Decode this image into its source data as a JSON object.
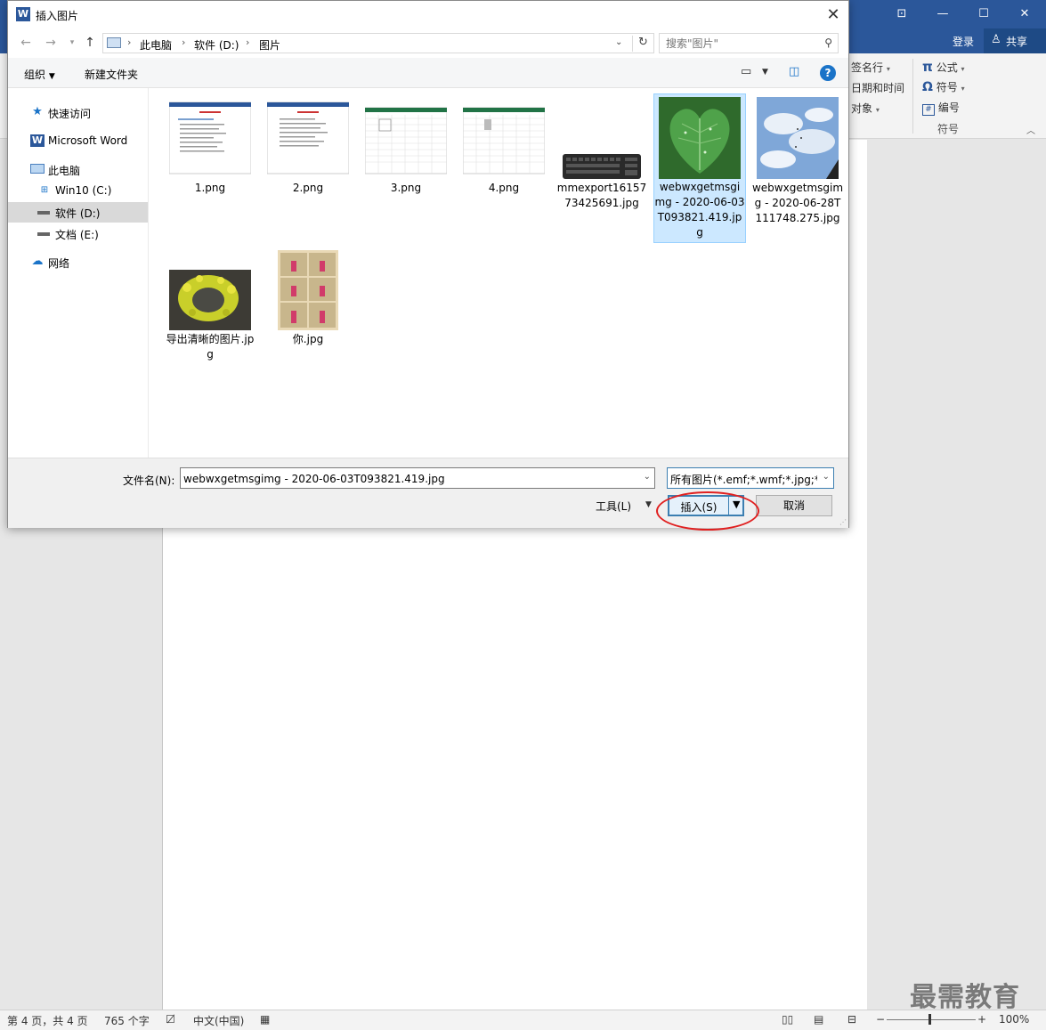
{
  "word": {
    "login": "登录",
    "share": "共享",
    "ribbon": {
      "signature_line": "签名行",
      "date_time": "日期和时间",
      "object": "对象",
      "formula": "公式",
      "symbol": "符号",
      "number": "编号",
      "group_label": "符号"
    },
    "status": {
      "page": "第 4 页，共 4 页",
      "words": "765 个字",
      "language": "中文(中国)",
      "zoom": "100%"
    },
    "watermark": "最需教育"
  },
  "dialog": {
    "title": "插入图片",
    "breadcrumb": [
      "此电脑",
      "软件 (D:)",
      "图片"
    ],
    "search_placeholder": "搜索\"图片\"",
    "organize": "组织",
    "new_folder": "新建文件夹",
    "nav": [
      {
        "label": "快速访问",
        "icon": "star-icon"
      },
      {
        "label": "Microsoft Word",
        "icon": "word-icon"
      },
      {
        "label": "此电脑",
        "icon": "computer-icon"
      },
      {
        "label": "Win10 (C:)",
        "icon": "drive-icon"
      },
      {
        "label": "软件 (D:)",
        "icon": "drive-icon",
        "selected": true
      },
      {
        "label": "文档 (E:)",
        "icon": "drive-icon"
      },
      {
        "label": "网络",
        "icon": "network-icon"
      }
    ],
    "files": [
      {
        "name": "1.png",
        "thumb": "doc"
      },
      {
        "name": "2.png",
        "thumb": "doc"
      },
      {
        "name": "3.png",
        "thumb": "sheet"
      },
      {
        "name": "4.png",
        "thumb": "sheet"
      },
      {
        "name": "mmexport1615773425691.jpg",
        "thumb": "keyboard"
      },
      {
        "name": "webwxgetmsgimg - 2020-06-03T093821.419.jpg",
        "thumb": "leaf",
        "selected": true
      },
      {
        "name": "webwxgetmsgimg - 2020-06-28T111748.275.jpg",
        "thumb": "sky"
      },
      {
        "name": "导出清晰的图片.jpg",
        "thumb": "flowers"
      },
      {
        "name": "你.jpg",
        "thumb": "collage"
      }
    ],
    "filename_label": "文件名(N):",
    "filename_value": "webwxgetmsgimg - 2020-06-03T093821.419.jpg",
    "filetype": "所有图片(*.emf;*.wmf;*.jpg;*.jp",
    "tools": "工具(L)",
    "insert": "插入(S)",
    "cancel": "取消"
  }
}
